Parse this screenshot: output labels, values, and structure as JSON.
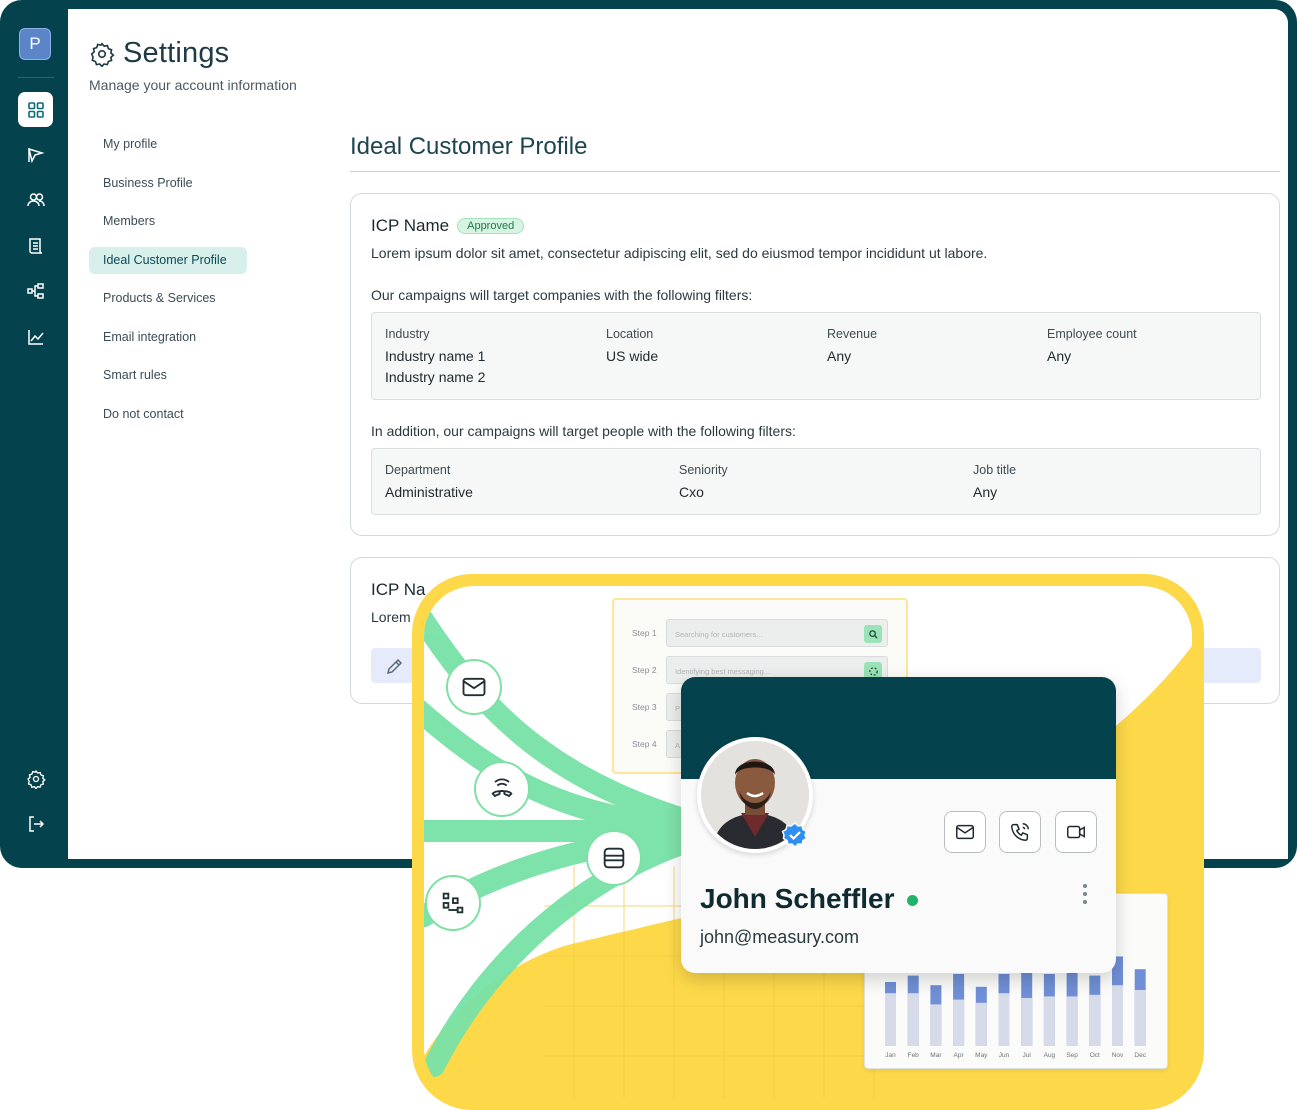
{
  "sidebar": {
    "avatar_letter": "P",
    "icons": [
      "dashboard-icon",
      "campaign-icon",
      "people-icon",
      "scroll-icon",
      "workflow-icon",
      "analytics-icon"
    ],
    "bottom_icons": [
      "settings-icon",
      "logout-icon"
    ]
  },
  "header": {
    "title": "Settings",
    "subtitle": "Manage your account information"
  },
  "settings_nav": [
    {
      "label": "My profile"
    },
    {
      "label": "Business Profile"
    },
    {
      "label": "Members"
    },
    {
      "label": "Ideal Customer Profile",
      "active": true
    },
    {
      "label": "Products & Services"
    },
    {
      "label": "Email integration"
    },
    {
      "label": "Smart rules"
    },
    {
      "label": "Do not contact"
    }
  ],
  "main": {
    "section_title": "Ideal Customer Profile",
    "icp_cards": [
      {
        "name": "ICP Name",
        "status": "Approved",
        "description": "Lorem ipsum dolor sit amet, consectetur adipiscing elit, sed do eiusmod tempor incididunt ut labore.",
        "company_filters_caption": "Our campaigns will target companies with the following filters:",
        "company_filters": {
          "industry_label": "Industry",
          "industry_values": [
            "Industry name 1",
            "Industry name 2"
          ],
          "location_label": "Location",
          "location_value": "US wide",
          "revenue_label": "Revenue",
          "revenue_value": "Any",
          "employee_label": "Employee count",
          "employee_value": "Any"
        },
        "people_filters_caption": "In addition, our campaigns will target people with the following filters:",
        "people_filters": {
          "department_label": "Department",
          "department_value": "Administrative",
          "seniority_label": "Seniority",
          "seniority_value": "Cxo",
          "job_label": "Job title",
          "job_value": "Any"
        }
      },
      {
        "name": "ICP Na",
        "description": "Lorem"
      }
    ]
  },
  "promo": {
    "steps": [
      {
        "label": "Step 1",
        "text": "Searching for customers..."
      },
      {
        "label": "Step 2",
        "text": "Identifying best messaging..."
      },
      {
        "label": "Step 3",
        "text": "P"
      },
      {
        "label": "Step 4",
        "text": "A"
      }
    ],
    "profile": {
      "name": "John Scheffler",
      "email": "john@measury.com",
      "online_color": "#20b36a"
    },
    "chart_data": {
      "type": "bar",
      "categories": [
        "Jan",
        "Feb",
        "Mar",
        "Apr",
        "May",
        "Jun",
        "Jul",
        "Aug",
        "Sep",
        "Oct",
        "Nov",
        "Dec"
      ],
      "series": [
        {
          "values": [
            40,
            44,
            38,
            45,
            37,
            45,
            46,
            45,
            48,
            44,
            56,
            48
          ]
        },
        {
          "values": [
            33,
            33,
            26,
            29,
            27,
            33,
            30,
            31,
            31,
            32,
            38,
            35
          ]
        }
      ]
    },
    "colors": {
      "brand_dark": "#04424e",
      "promo_yellow": "#fdd94a",
      "flow_green": "#6ee0a0",
      "bar_blue": "#6f8fd6",
      "bar_light": "#d7dbe9"
    }
  }
}
